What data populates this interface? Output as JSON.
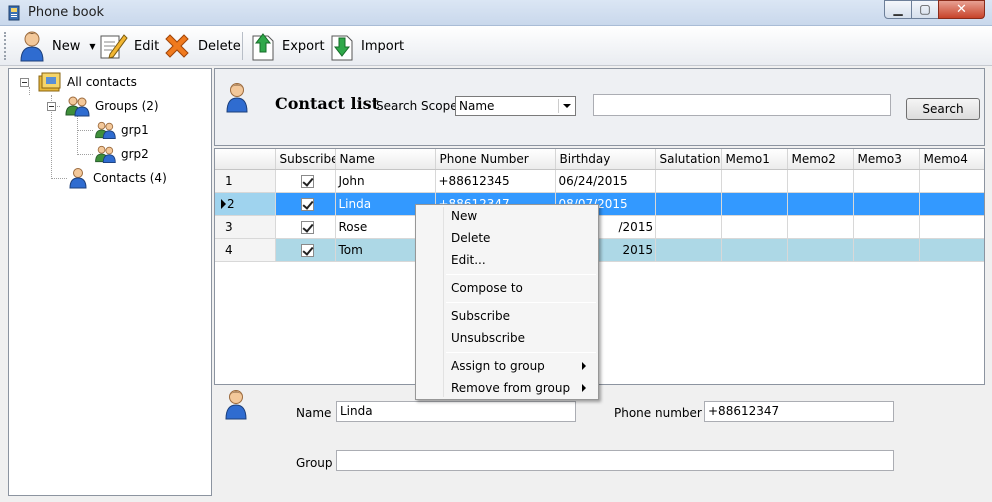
{
  "window": {
    "title": "Phone book"
  },
  "toolbar": {
    "new_label": "New",
    "edit_label": "Edit",
    "delete_label": "Delete",
    "export_label": "Export",
    "import_label": "Import"
  },
  "tree": {
    "root": "All contacts",
    "groups": "Groups (2)",
    "group_items": [
      "grp1",
      "grp2"
    ],
    "contacts": "Contacts (4)"
  },
  "header": {
    "title": "Contact list",
    "scope_label": "Search Scope",
    "scope_value": "Name",
    "search_value": "",
    "search_button": "Search"
  },
  "grid": {
    "columns": [
      "Subscribe",
      "Name",
      "Phone Number",
      "Birthday",
      "Salutation",
      "Memo1",
      "Memo2",
      "Memo3",
      "Memo4"
    ],
    "rows": [
      {
        "num": "1",
        "subscribe": true,
        "name": "John",
        "phone": "+88612345",
        "birthday": "06/24/2015"
      },
      {
        "num": "2",
        "subscribe": true,
        "name": "Linda",
        "phone": "+88612347",
        "birthday": "08/07/2015"
      },
      {
        "num": "3",
        "subscribe": true,
        "name": "Rose",
        "phone": "",
        "birthday": "/2015"
      },
      {
        "num": "4",
        "subscribe": true,
        "name": "Tom",
        "phone": "",
        "birthday": "2015"
      }
    ]
  },
  "detail": {
    "name_label": "Name",
    "name_value": "Linda",
    "phone_label": "Phone number",
    "phone_value": "+88612347",
    "group_label": "Group",
    "group_value": ""
  },
  "context_menu": {
    "new": "New",
    "delete": "Delete",
    "edit": "Edit...",
    "compose": "Compose to",
    "subscribe": "Subscribe",
    "unsubscribe": "Unsubscribe",
    "assign": "Assign to group",
    "remove": "Remove from group"
  },
  "colors": {
    "selection": "#3399ff",
    "alt_row": "#add8e6"
  }
}
